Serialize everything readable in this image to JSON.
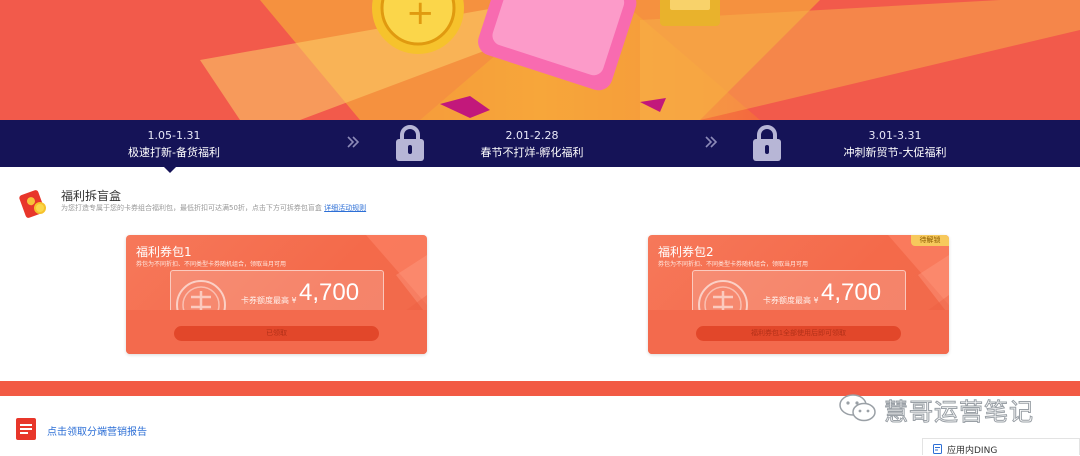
{
  "stages": [
    {
      "dates": "1.05-1.31",
      "name": "极速打新-备货福利"
    },
    {
      "dates": "2.01-2.28",
      "name": "春节不打烊-孵化福利"
    },
    {
      "dates": "3.01-3.31",
      "name": "冲刺新贸节-大促福利"
    }
  ],
  "section": {
    "title": "福利拆盲盒",
    "desc": "为您打造专属于您的卡券组合福利包，最低折扣可达满50折，点击下方可拆券包盲盒",
    "rule_link": "详细活动规则"
  },
  "cards": [
    {
      "title": "福利券包1",
      "sub": "券包为不同折扣、不同类型卡券随机组合，领取当月可用",
      "amount_label": "卡券额度最高 ¥",
      "amount": "4,700",
      "action": "已领取",
      "badge": ""
    },
    {
      "title": "福利券包2",
      "sub": "券包为不同折扣、不同类型卡券随机组合，领取当月可用",
      "amount_label": "卡券额度最高 ¥",
      "amount": "4,700",
      "action": "福利券包1全部使用后即可领取",
      "badge": "待解锁"
    }
  ],
  "footer": {
    "report_link": "点击领取分端营销报告",
    "watermark": "慧哥运营笔记",
    "ding_tab": "应用内DING"
  },
  "colors": {
    "stage_bar": "#151357",
    "card_bg": "#f46a4a",
    "link": "#2d6fd6",
    "badge": "#f7c95c"
  }
}
